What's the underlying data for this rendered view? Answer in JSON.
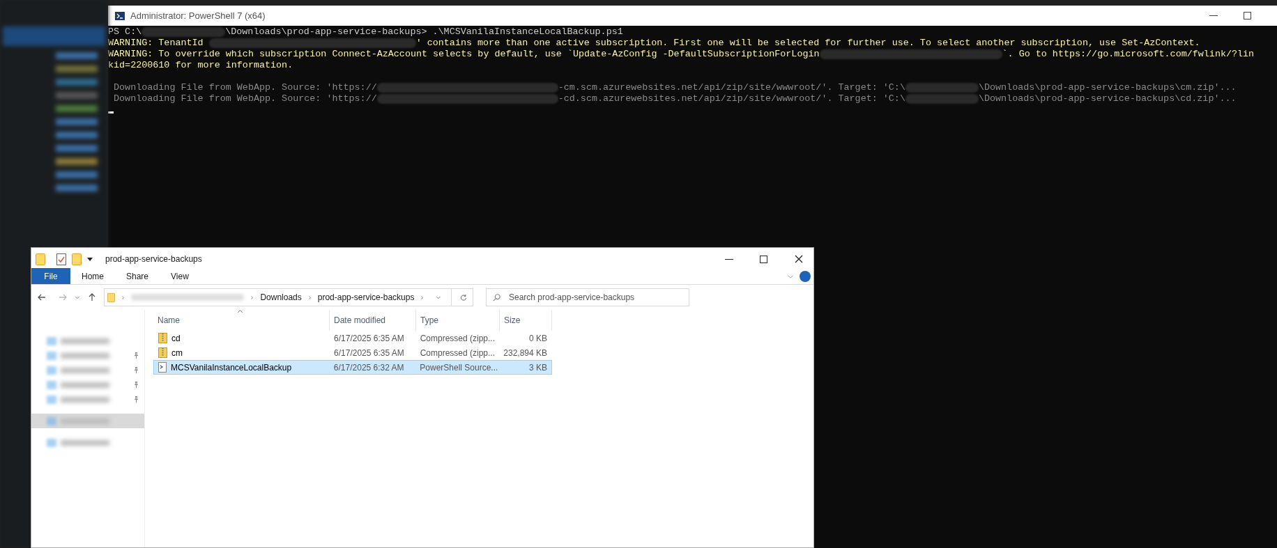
{
  "terminal": {
    "title": "Administrator: PowerShell 7 (x64)",
    "lines": [
      {
        "kind": "prompt",
        "segments": [
          {
            "kind": "text",
            "text": "PS C:\\"
          },
          {
            "kind": "redacted"
          },
          {
            "kind": "text",
            "text": "\\Downloads\\prod-app-service-backups> .\\MCSVanilaInstanceLocalBackup.ps1"
          }
        ]
      },
      {
        "kind": "warning",
        "segments": [
          {
            "kind": "text",
            "text": "WARNING: TenantId "
          },
          {
            "kind": "redacted"
          },
          {
            "kind": "text",
            "text": "' contains more than one active subscription. First one will be selected for further use. To select another subscription, use Set-AzContext."
          }
        ]
      },
      {
        "kind": "warning",
        "segments": [
          {
            "kind": "text",
            "text": "WARNING: To override which subscription Connect-AzAccount selects by default, use `Update-AzConfig -DefaultSubscriptionForLogin"
          },
          {
            "kind": "redacted"
          },
          {
            "kind": "text",
            "text": "`. Go to https://go.microsoft.com/fwlink/?lin"
          }
        ]
      },
      {
        "kind": "warning",
        "segments": [
          {
            "kind": "text",
            "text": "kid=2200610 for more information."
          }
        ]
      },
      {
        "kind": "blank"
      },
      {
        "kind": "progress",
        "segments": [
          {
            "kind": "text",
            "text": " Downloading File from WebApp. Source: 'https://"
          },
          {
            "kind": "redacted"
          },
          {
            "kind": "text",
            "text": "-cm.scm.azurewebsites.net/api/zip/site/wwwroot/'. Target: 'C:\\"
          },
          {
            "kind": "redacted"
          },
          {
            "kind": "text",
            "text": "\\Downloads\\prod-app-service-backups\\cm.zip'..."
          }
        ]
      },
      {
        "kind": "progress",
        "segments": [
          {
            "kind": "text",
            "text": " Downloading File from WebApp. Source: 'https://"
          },
          {
            "kind": "redacted"
          },
          {
            "kind": "text",
            "text": "-cd.scm.azurewebsites.net/api/zip/site/wwwroot/'. Target: 'C:\\"
          },
          {
            "kind": "redacted"
          },
          {
            "kind": "text",
            "text": "\\Downloads\\prod-app-service-backups\\cd.zip'..."
          }
        ]
      }
    ]
  },
  "explorer": {
    "title": "prod-app-service-backups",
    "ribbon_tabs": [
      {
        "label": "File",
        "selected": true
      },
      {
        "label": "Home",
        "selected": false
      },
      {
        "label": "Share",
        "selected": false
      },
      {
        "label": "View",
        "selected": false
      }
    ],
    "breadcrumb": [
      {
        "kind": "redacted"
      },
      {
        "kind": "folder",
        "label": "Downloads"
      },
      {
        "kind": "folder",
        "label": "prod-app-service-backups"
      }
    ],
    "search": {
      "placeholder": "Search prod-app-service-backups"
    },
    "nav_pane": [
      {
        "pinned": false,
        "selected": false
      },
      {
        "pinned": true,
        "selected": false
      },
      {
        "pinned": true,
        "selected": false
      },
      {
        "pinned": true,
        "selected": false
      },
      {
        "pinned": true,
        "selected": false
      },
      {
        "pinned": false,
        "selected": true
      },
      {
        "pinned": false,
        "selected": false
      }
    ],
    "columns": [
      "Name",
      "Date modified",
      "Type",
      "Size"
    ],
    "files": [
      {
        "kind": "zip",
        "name": "cd",
        "date": "6/17/2025 6:35 AM",
        "type": "Compressed (zipp...",
        "size": "0 KB",
        "selected": false
      },
      {
        "kind": "zip",
        "name": "cm",
        "date": "6/17/2025 6:35 AM",
        "type": "Compressed (zipp...",
        "size": "232,894 KB",
        "selected": false
      },
      {
        "kind": "script",
        "name": "MCSVanilaInstanceLocalBackup",
        "date": "6/17/2025 6:32 AM",
        "type": "PowerShell Source...",
        "size": "3 KB",
        "selected": true
      }
    ]
  }
}
